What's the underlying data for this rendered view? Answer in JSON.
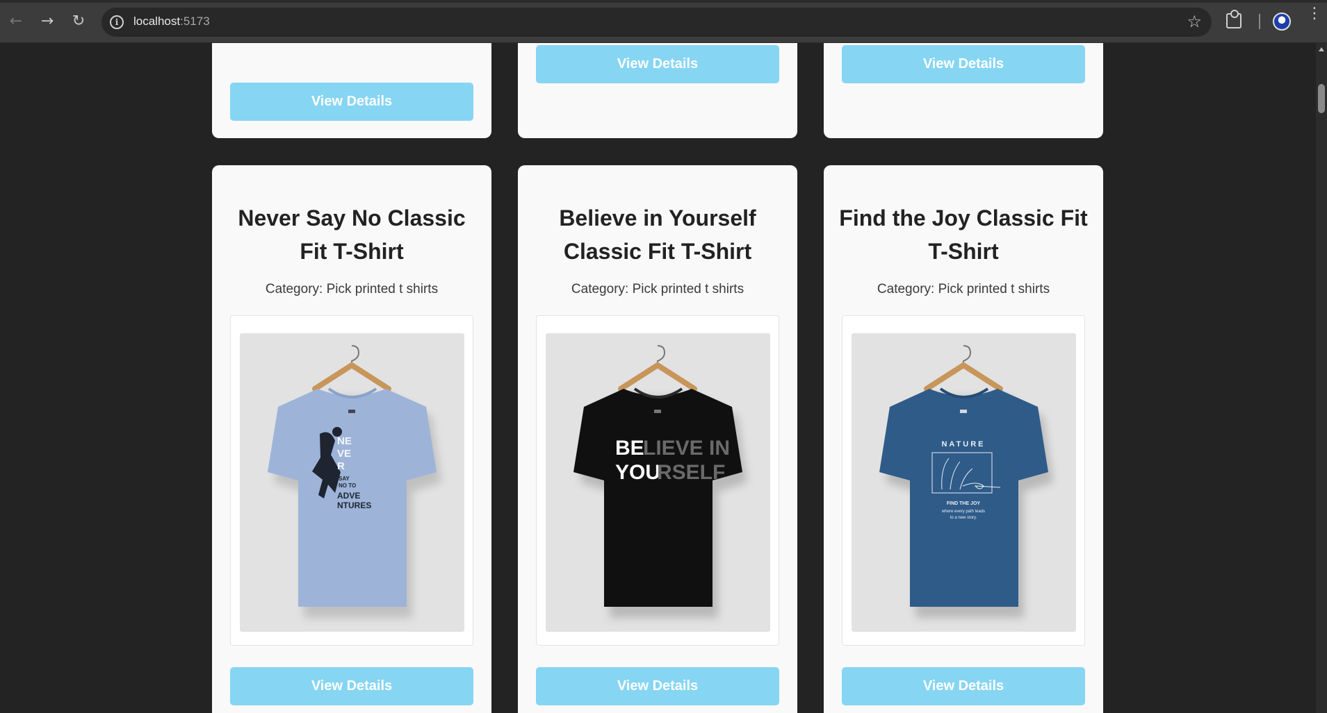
{
  "browser": {
    "url_host": "localhost",
    "url_port": ":5173"
  },
  "icons": {
    "back": "back-arrow-icon",
    "forward": "forward-arrow-icon",
    "reload": "reload-icon",
    "info": "site-info-icon",
    "star": "bookmark-star-icon",
    "extensions": "extensions-icon",
    "profile": "profile-avatar-icon",
    "menu": "kebab-menu-icon"
  },
  "colors": {
    "button": "#86d5f3",
    "card": "#f9f9f9",
    "page_bg": "#232323"
  },
  "top_row": [
    {
      "button_label": "View Details"
    },
    {
      "button_label": "View Details"
    },
    {
      "button_label": "View Details"
    }
  ],
  "products": [
    {
      "title": "Never Say No Classic Fit T-Shirt",
      "category": "Category: Pick printed t shirts",
      "button_label": "View Details",
      "shirt_color": "#9db4d8",
      "print_text": [
        "NE VE R",
        "SAY NO TO ADVE NTURES"
      ]
    },
    {
      "title": "Believe in Yourself Classic Fit T-Shirt",
      "category": "Category: Pick printed t shirts",
      "button_label": "View Details",
      "shirt_color": "#101010",
      "print_text": [
        "BELIEVE IN",
        "YOURSELF"
      ]
    },
    {
      "title": "Find the Joy Classic Fit T-Shirt",
      "category": "Category: Pick printed t shirts",
      "button_label": "View Details",
      "shirt_color": "#2f5b89",
      "print_text": [
        "NATURE",
        "FIND THE JOY",
        "where every path leads",
        "to a new story."
      ]
    }
  ]
}
